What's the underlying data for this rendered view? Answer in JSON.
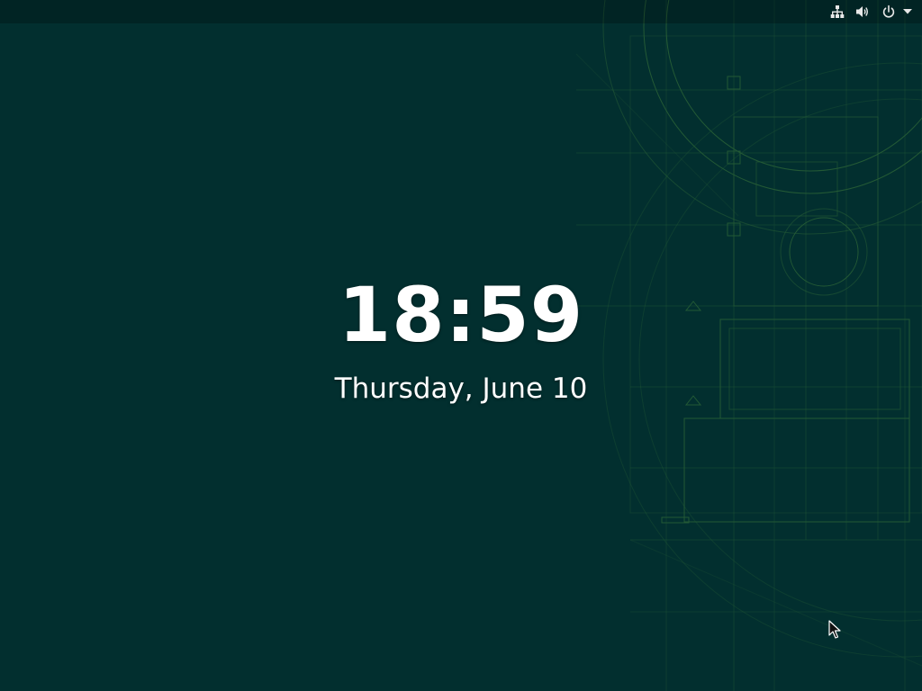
{
  "lock_screen": {
    "time": "18:59",
    "date": "Thursday, June 10"
  },
  "top_bar": {
    "status_icons": [
      "network-wired-icon",
      "volume-icon",
      "power-icon",
      "menu-arrow-icon"
    ]
  },
  "colors": {
    "background": "#022f2f",
    "blueprint_line": "#3f7d3a",
    "text": "#ffffff"
  }
}
